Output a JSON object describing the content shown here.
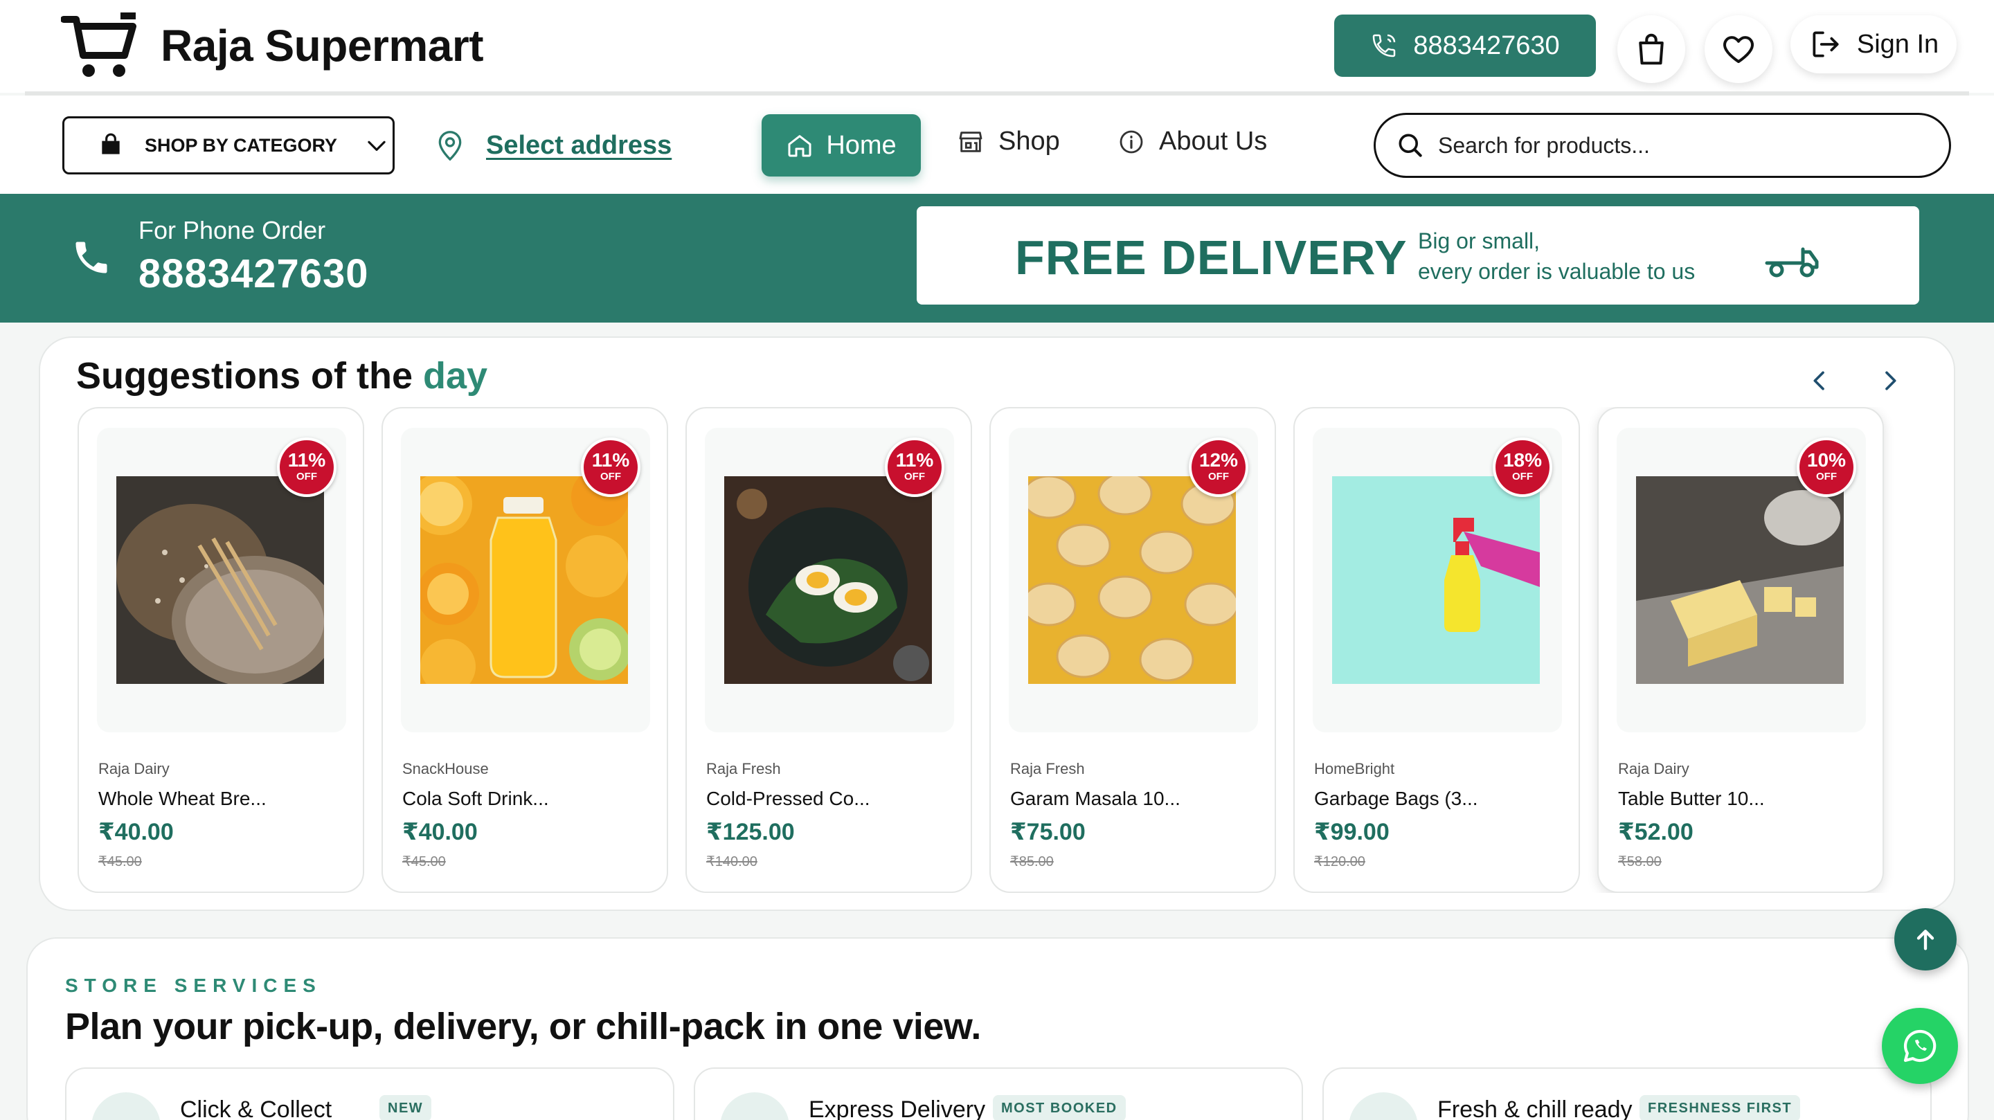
{
  "header": {
    "brand_name": "Raja Supermart",
    "phone": "8883427630",
    "signin_label": "Sign In"
  },
  "nav": {
    "category_label": "SHOP BY CATEGORY",
    "address_link": "Select address",
    "home_label": "Home",
    "shop_label": "Shop",
    "about_label": "About Us",
    "search_placeholder": "Search for products..."
  },
  "promo": {
    "phone_order_label": "For Phone Order",
    "phone_order_number": "8883427630",
    "delivery_title": "FREE DELIVERY",
    "delivery_line1": "Big or small,",
    "delivery_line2": "every order is valuable to us"
  },
  "suggestions": {
    "title_main": "Suggestions of the",
    "title_accent": "day",
    "products": [
      {
        "brand": "Raja Dairy",
        "name": "Whole Wheat Bre...",
        "price": "₹40.00",
        "mrp": "₹45.00",
        "discount": "11%",
        "off": "OFF",
        "image": "bread"
      },
      {
        "brand": "SnackHouse",
        "name": "Cola Soft Drink...",
        "price": "₹40.00",
        "mrp": "₹45.00",
        "discount": "11%",
        "off": "OFF",
        "image": "juice"
      },
      {
        "brand": "Raja Fresh",
        "name": "Cold-Pressed Co...",
        "price": "₹125.00",
        "mrp": "₹140.00",
        "discount": "11%",
        "off": "OFF",
        "image": "egg-plate"
      },
      {
        "brand": "Raja Fresh",
        "name": "Garam Masala 10...",
        "price": "₹75.00",
        "mrp": "₹85.00",
        "discount": "12%",
        "off": "OFF",
        "image": "chips"
      },
      {
        "brand": "HomeBright",
        "name": "Garbage Bags (3...",
        "price": "₹99.00",
        "mrp": "₹120.00",
        "discount": "18%",
        "off": "OFF",
        "image": "spray"
      },
      {
        "brand": "Raja Dairy",
        "name": "Table Butter 10...",
        "price": "₹52.00",
        "mrp": "₹58.00",
        "discount": "10%",
        "off": "OFF",
        "image": "butter"
      }
    ]
  },
  "services": {
    "kicker": "STORE SERVICES",
    "heading": "Plan your pick-up, delivery, or chill-pack in one view.",
    "cards": [
      {
        "name": "Click & Collect",
        "tag": "NEW"
      },
      {
        "name": "Express Delivery",
        "tag": "MOST BOOKED"
      },
      {
        "name": "Fresh & chill ready",
        "tag": "FRESHNESS FIRST"
      }
    ]
  },
  "colors": {
    "brand_green": "#2b7a6b",
    "accent_green": "#2e8a75",
    "discount_red": "#c8102e",
    "whatsapp_green": "#25d366"
  }
}
